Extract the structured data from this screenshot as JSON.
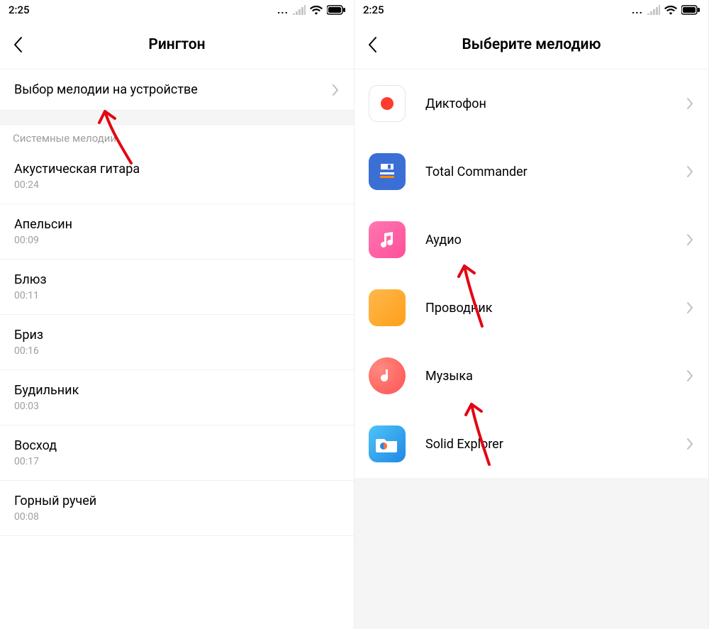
{
  "status": {
    "time": "2:25",
    "dots": "..."
  },
  "left": {
    "title": "Рингтон",
    "pick_on_device": "Выбор мелодии на устройстве",
    "section_label": "Системные мелодии",
    "ringtones": [
      {
        "name": "Акустическая гитара",
        "dur": "00:24"
      },
      {
        "name": "Апельсин",
        "dur": "00:09"
      },
      {
        "name": "Блюз",
        "dur": "00:11"
      },
      {
        "name": "Бриз",
        "dur": "00:16"
      },
      {
        "name": "Будильник",
        "dur": "00:03"
      },
      {
        "name": "Восход",
        "dur": "00:17"
      },
      {
        "name": "Горный ручей",
        "dur": "00:08"
      }
    ]
  },
  "right": {
    "title": "Выберите мелодию",
    "apps": [
      {
        "id": "recorder",
        "label": "Диктофон"
      },
      {
        "id": "totalcmd",
        "label": "Total Commander"
      },
      {
        "id": "audio",
        "label": "Аудио"
      },
      {
        "id": "explorer",
        "label": "Проводник"
      },
      {
        "id": "music",
        "label": "Музыка"
      },
      {
        "id": "solid",
        "label": "Solid Explorer"
      }
    ]
  }
}
